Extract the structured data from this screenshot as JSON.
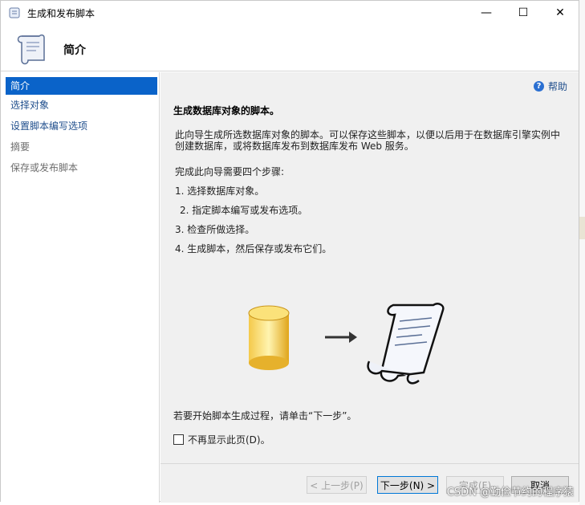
{
  "window": {
    "title": "生成和发布脚本",
    "controls": {
      "minimize": "—",
      "maximize": "☐",
      "close": "✕"
    }
  },
  "header": {
    "title": "简介",
    "icon": "scroll-icon"
  },
  "sidebar": {
    "items": [
      {
        "label": "简介",
        "state": "active"
      },
      {
        "label": "选择对象",
        "state": "link"
      },
      {
        "label": "设置脚本编写选项",
        "state": "link"
      },
      {
        "label": "摘要",
        "state": "disabled"
      },
      {
        "label": "保存或发布脚本",
        "state": "disabled"
      }
    ]
  },
  "main": {
    "help_label": "帮助",
    "title": "生成数据库对象的脚本。",
    "description": "此向导生成所选数据库对象的脚本。可以保存这些脚本，以便以后用于在数据库引擎实例中创建数据库，或将数据库发布到数据库发布 Web 服务。",
    "steps_title": "完成此向导需要四个步骤:",
    "steps": [
      "1. 选择数据库对象。",
      "2. 指定脚本编写或发布选项。",
      "3. 检查所做选择。",
      "4. 生成脚本，然后保存或发布它们。"
    ],
    "start_text": "若要开始脚本生成过程，请单击“下一步”。",
    "checkbox_label": "不再显示此页(D)。"
  },
  "footer": {
    "prev": "< 上一步(P)",
    "next": "下一步(N) >",
    "finish": "完成(F)",
    "cancel": "取消"
  },
  "watermark": "CSDN @勤俭节约的程序猿",
  "colors": {
    "accent": "#0a63c9",
    "link": "#1f4e8c",
    "panel": "#f0f0f0"
  }
}
